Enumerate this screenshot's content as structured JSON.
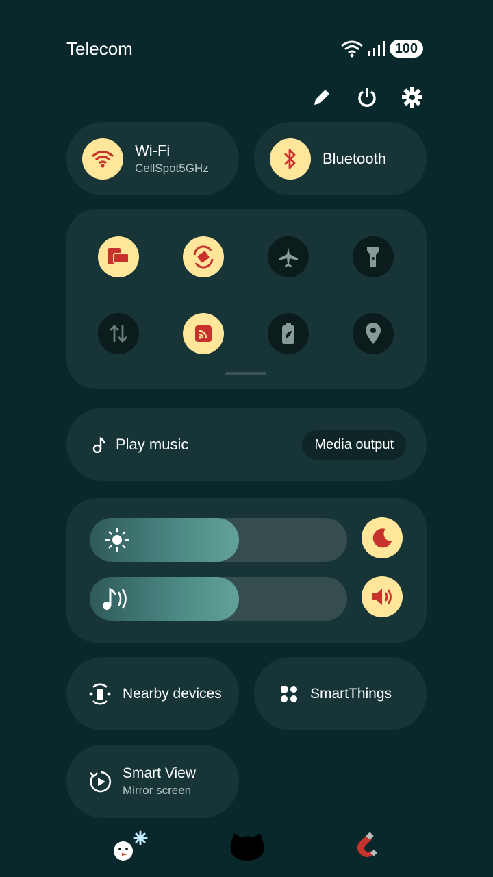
{
  "status_bar": {
    "carrier": "Telecom",
    "battery": "100",
    "icons": [
      "wifi-icon",
      "signal-icon",
      "battery-icon"
    ]
  },
  "top_actions": [
    "edit-icon",
    "power-icon",
    "settings-icon"
  ],
  "wifi": {
    "label": "Wi-Fi",
    "network": "CellSpot5GHz",
    "state": "on"
  },
  "bluetooth": {
    "label": "Bluetooth",
    "state": "on"
  },
  "quick_tiles": [
    {
      "icon": "device-connect-icon",
      "state": "on"
    },
    {
      "icon": "auto-rotate-icon",
      "state": "on"
    },
    {
      "icon": "airplane-icon",
      "state": "off"
    },
    {
      "icon": "flashlight-icon",
      "state": "off"
    },
    {
      "icon": "mobile-data-icon",
      "state": "off"
    },
    {
      "icon": "nfc-icon",
      "state": "on"
    },
    {
      "icon": "power-saving-icon",
      "state": "off"
    },
    {
      "icon": "location-icon",
      "state": "off"
    }
  ],
  "media": {
    "label": "Play music",
    "output_button": "Media output"
  },
  "brightness": {
    "level": 0.58,
    "icon": "sun-icon",
    "side_icon": "moon-icon"
  },
  "volume": {
    "level": 0.58,
    "icon": "music-volume-icon",
    "side_icon": "speaker-icon"
  },
  "nearby": {
    "label": "Nearby devices"
  },
  "smartthings": {
    "label": "SmartThings"
  },
  "smart_view": {
    "label": "Smart View",
    "sub": "Mirror screen"
  },
  "dock_icons": [
    "snowman-icon",
    "cat-icon",
    "magnet-icon"
  ],
  "colors": {
    "background": "#08282b",
    "tile_on": "#ffe69a",
    "tile_icon_on": "#c8322d",
    "panel": "#173537"
  }
}
